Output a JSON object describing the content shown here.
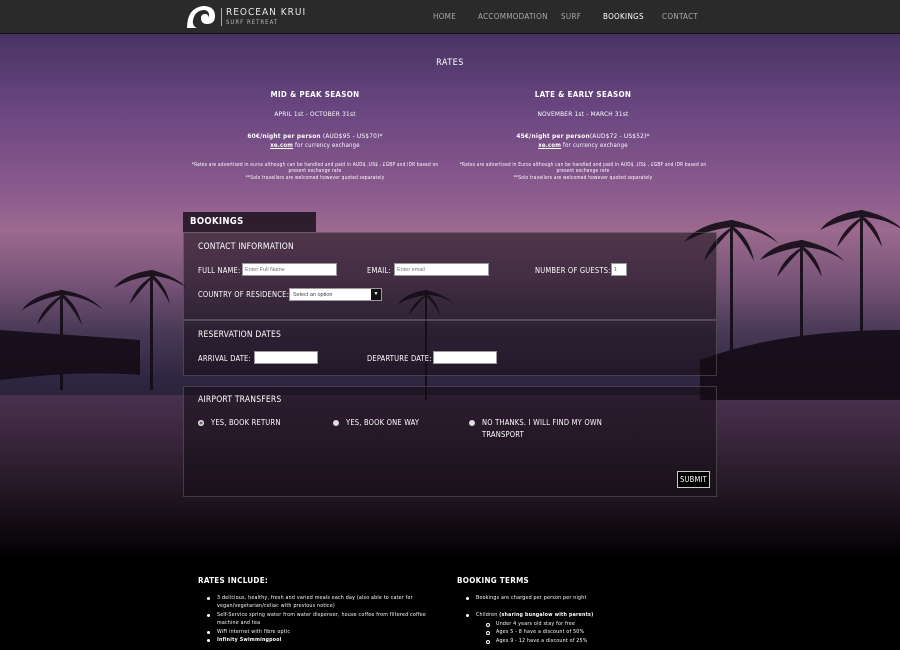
{
  "nav": {
    "logo_name": "REOCEAN KRUI",
    "logo_sub": "SURF RETREAT",
    "items": [
      "HOME",
      "ACCOMMODATION",
      "SURF",
      "BOOKINGS",
      "CONTACT"
    ],
    "active": "BOOKINGS"
  },
  "rates": {
    "title": "RATES",
    "seasons": [
      {
        "title": "MID & PEAK SEASON",
        "dates": "APRIL 1st - OCTOBER 31st",
        "price_bold": "60€/night per person",
        "price_rest": " (AUD$95 - US$70)*",
        "xe_link": "xe.com",
        "xe_rest": " for currency exchange",
        "note1": "*Rates are advertised in euros although can be handled and paid in AUD$ ,US$ , £GBP and IDR based on present exchange rate",
        "note2": "**Solo travellers are welcomed however quoted separately"
      },
      {
        "title": "LATE & EARLY SEASON",
        "dates": "NOVEMBER 1st - MARCH 31st",
        "price_bold": "45€/night per person",
        "price_rest": "(AUD$72 - US$52)*",
        "xe_link": "xe.com",
        "xe_rest": " for currency exchange",
        "note1": "*Rates are advertised in Euros although can be handled and paid in AUD$ ,US$ , £GBP and IDR based on present exchange rate",
        "note2": "**Solo travellers are welcomed however quoted separately"
      }
    ]
  },
  "bookings": {
    "tab": "BOOKINGS",
    "contact": {
      "title": "CONTACT INFORMATION",
      "full_name_label": "FULL NAME:",
      "full_name_placeholder": "Enter Full Name",
      "email_label": "EMAIL:",
      "email_placeholder": "Enter email",
      "guests_label": "NUMBER OF GUESTS:",
      "guests_value": "1",
      "country_label": "COUNTRY OF RESIDENCE:",
      "country_value": "Select an option"
    },
    "dates": {
      "title": "RESERVATION DATES",
      "arrival_label": "ARRIVAL DATE:",
      "departure_label": "DEPARTURE DATE:"
    },
    "transfers": {
      "title": "AIRPORT TRANSFERS",
      "options": [
        "YES, BOOK RETURN",
        "YES, BOOK ONE WAY",
        "NO THANKS. I WILL FIND MY OWN TRANSPORT"
      ],
      "selected": 0
    },
    "submit": "SUBMIT"
  },
  "info": {
    "includes_title": "RATES INCLUDE:",
    "includes": [
      "3 delicious, healthy, fresh and varied meals each day (also able to cater for vegan/vegetarian/celiac with previous notice)",
      "Self-Service spring water from water dispenser, house coffee from filtered coffee machine and tea",
      "WiFi internet with fibre optic",
      "Infinity Swimmingpool"
    ],
    "terms_title": "BOOKING TERMS",
    "terms": [
      "Bookings are charged per person per night",
      "Children",
      "(sharing bungalow with parents)"
    ],
    "children": [
      "Under 4 years old stay for free",
      "Ages 5 - 8 have a discount of 50%",
      "Ages 9 - 12 have a discount of 25%"
    ]
  }
}
